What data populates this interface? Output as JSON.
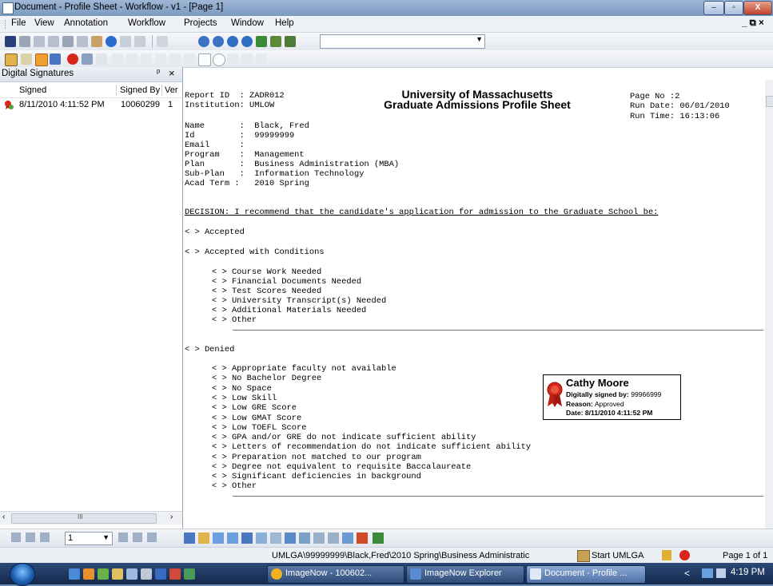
{
  "window": {
    "title": "Document - Profile Sheet - Workflow - v1 - [Page 1]",
    "min_label": "–",
    "max_label": "▫",
    "close_label": "X"
  },
  "menu": {
    "items": [
      "File",
      "View",
      "Annotation",
      "Workflow",
      "Projects",
      "Window",
      "Help"
    ],
    "mdi_controls": "_ ⧉ ×"
  },
  "toolbar": {
    "page_combo_value": ""
  },
  "left_panel": {
    "title": "Digital Signatures",
    "pin": "ᵖ",
    "close": "×",
    "columns": [
      "Signed",
      "Signed By",
      "Ver"
    ],
    "rows": [
      {
        "signed": "8/11/2010 4:11:52 PM",
        "signed_by": "10060299",
        "ver": "1"
      }
    ],
    "scroll_thumb": "III"
  },
  "document": {
    "report_id_line": "Report ID  : ZADR012",
    "institution_line": "Institution: UMLOW",
    "heading1": "University of Massachusetts",
    "heading2": "Graduate Admissions Profile Sheet",
    "page_no": "Page No :2",
    "run_date": "Run Date: 06/01/2010",
    "run_time": "Run Time: 16:13:06",
    "fields": [
      "Name       :  Black, Fred",
      "Id         :  99999999",
      "Email      :",
      "Program    :  Management",
      "Plan       :  Business Administration (MBA)",
      "Sub-Plan   :  Information Technology",
      "Acad Term :   2010 Spring"
    ],
    "decision": "DECISION: I recommend that the candidate's application for admission to the Graduate School be:",
    "accepted": "< > Accepted",
    "accepted_conditions": "< > Accepted with Conditions",
    "conditions": [
      "< > Course Work Needed",
      "< > Financial Documents Needed",
      "< > Test Scores Needed",
      "< > University Transcript(s) Needed",
      "< > Additional Materials Needed",
      "< > Other"
    ],
    "denied": "< > Denied",
    "denied_reasons": [
      "< > Appropriate faculty not available",
      "< > No Bachelor Degree",
      "< > No Space",
      "< > Low Skill",
      "< > Low GRE Score",
      "< > Low GMAT Score",
      "< > Low TOEFL Score",
      "< > GPA and/or GRE do not indicate sufficient ability",
      "< > Letters of recommendation do not indicate sufficient ability",
      "< > Preparation not matched to our program",
      "< > Degree not equivalent to requisite Baccalaureate",
      "< > Significant deficiencies in background",
      "< > Other"
    ]
  },
  "signature": {
    "name": "Cathy Moore",
    "signed_by_label": "Digitally signed by:",
    "signed_by_value": "99966999",
    "reason_label": "Reason:",
    "reason_value": "Approved",
    "date_label": "Date:",
    "date_value": "8/11/2010 4:11:52 PM"
  },
  "navbar": {
    "page_value": "1"
  },
  "statusbar": {
    "path": "UMLGA\\99999999\\Black,Fred\\2010 Spring\\Business Administratic",
    "start_label": "Start UMLGA",
    "page_label": "Page 1 of 1"
  },
  "taskbar": {
    "buttons": [
      "ImageNow - 100602...",
      "ImageNow Explorer",
      "Document - Profile ..."
    ],
    "time": "4:19 PM",
    "tray_arrow": "<"
  },
  "colors": {
    "titlebar": "#8aa6cc",
    "taskbar": "#1e3760",
    "ribbon_red": "#d8261c"
  }
}
